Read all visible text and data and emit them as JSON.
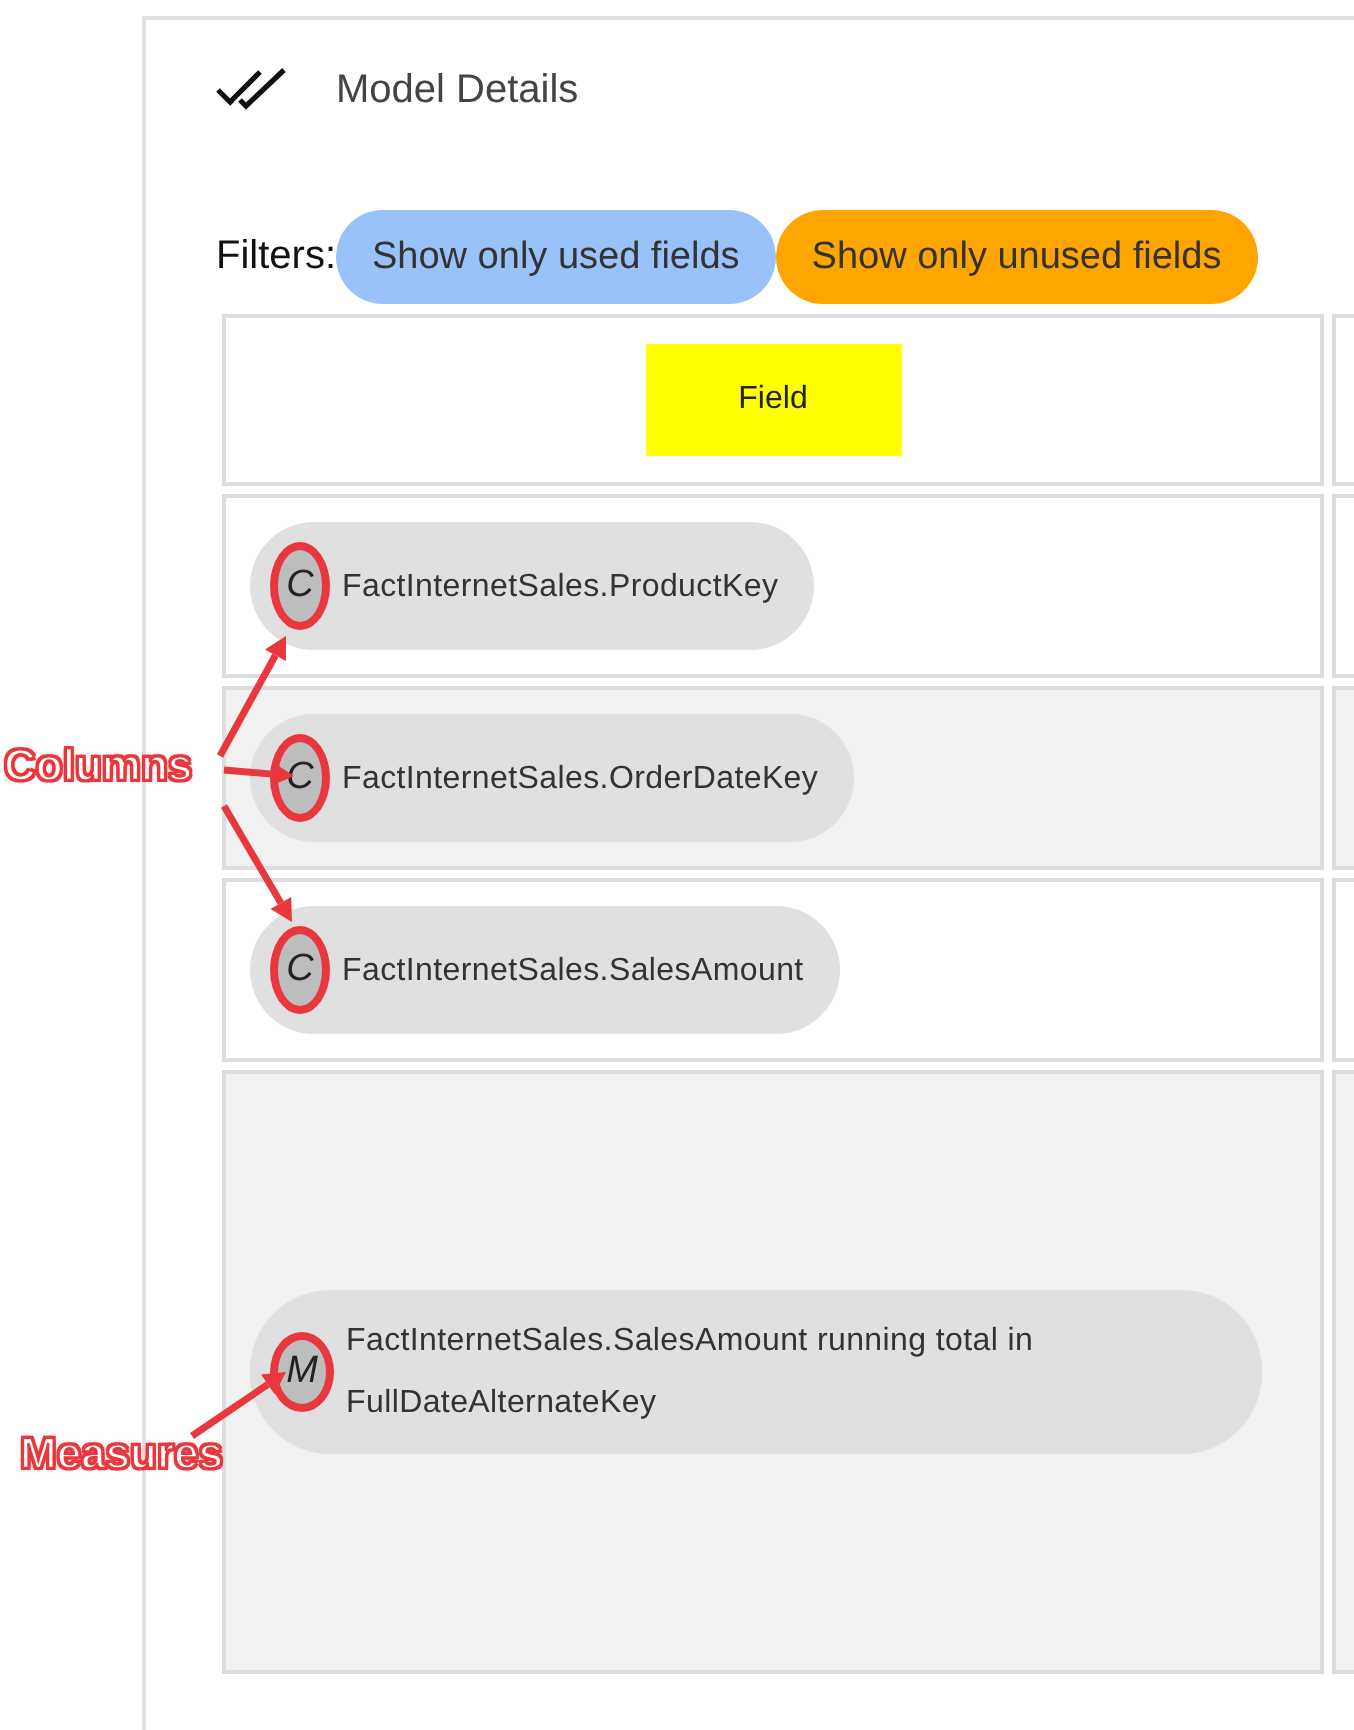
{
  "header": {
    "title": "Model Details"
  },
  "filters": {
    "label": "Filters:",
    "buttons": [
      {
        "label": "Show only used fields",
        "color": "#99c2fb"
      },
      {
        "label": "Show only unused fields",
        "color": "#ffa500"
      }
    ]
  },
  "table": {
    "columns": [
      "Field"
    ],
    "rows": [
      {
        "kind": "column",
        "badge": "C",
        "field": "FactInternetSales.ProductKey"
      },
      {
        "kind": "column",
        "badge": "C",
        "field": "FactInternetSales.OrderDateKey"
      },
      {
        "kind": "column",
        "badge": "C",
        "field": "FactInternetSales.SalesAmount"
      },
      {
        "kind": "measure",
        "badge": "M",
        "field": "FactInternetSales.SalesAmount running total in FullDateAlternateKey"
      }
    ]
  },
  "annotations": [
    {
      "label": "Columns"
    },
    {
      "label": "Measures"
    }
  ]
}
